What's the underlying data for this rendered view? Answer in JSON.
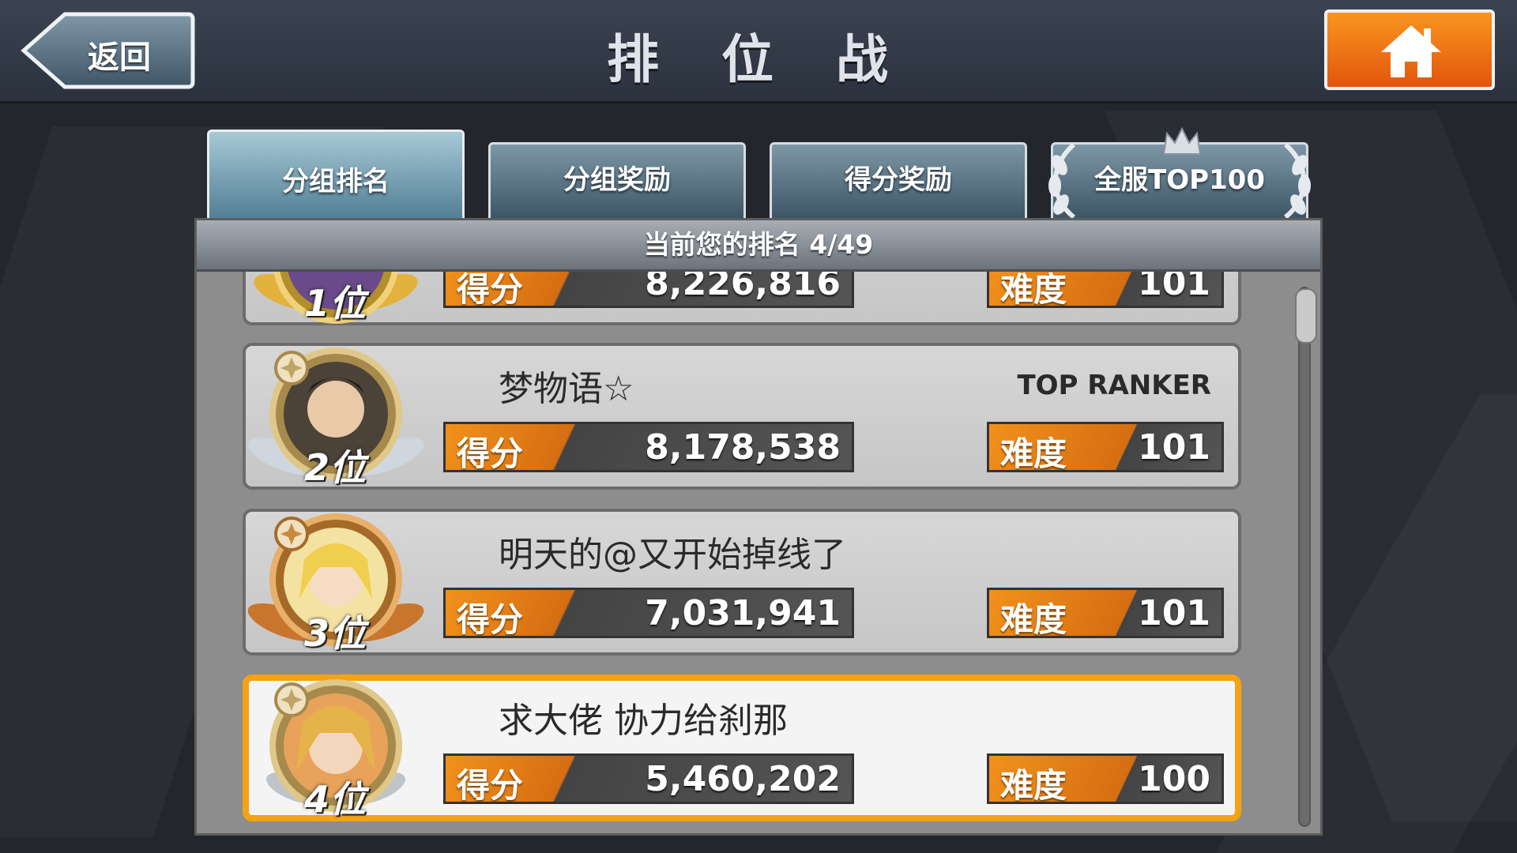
{
  "header": {
    "back_label": "返回",
    "title": "排 位 战",
    "home_icon": "home-icon"
  },
  "tabs": [
    {
      "label": "分组排名",
      "active": true
    },
    {
      "label": "分组奖励",
      "active": false
    },
    {
      "label": "得分奖励",
      "active": false
    },
    {
      "label": "全服TOP100",
      "active": false
    }
  ],
  "rank_summary": "当前您的排名 4/49",
  "score_label": "得分",
  "difficulty_label": "难度",
  "players": [
    {
      "rank": "1位",
      "name": "",
      "title": "",
      "score": "8,226,816",
      "difficulty": "101",
      "badge": "gold"
    },
    {
      "rank": "2位",
      "name": "梦物语☆",
      "title": "TOP RANKER",
      "score": "8,178,538",
      "difficulty": "101",
      "badge": "silver"
    },
    {
      "rank": "3位",
      "name": "明天的@又开始掉线了",
      "title": "",
      "score": "7,031,941",
      "difficulty": "101",
      "badge": "bronze"
    },
    {
      "rank": "4位",
      "name": "求大佬 协力给刹那",
      "title": "",
      "score": "5,460,202",
      "difficulty": "100",
      "badge": "silver",
      "is_me": true
    }
  ],
  "colors": {
    "accent_orange": "#f2911c",
    "highlight_border": "#f3a313",
    "gold": "#e2b23c",
    "silver": "#cfd6dd",
    "bronze": "#c9752e"
  }
}
